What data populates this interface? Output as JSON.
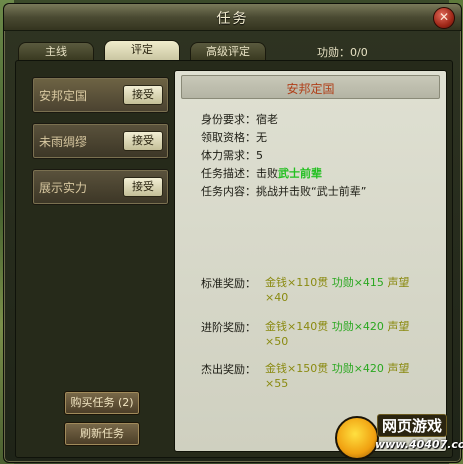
{
  "window": {
    "title": "任务",
    "close_label": "✕"
  },
  "tabs": [
    {
      "label": "主线",
      "active": false
    },
    {
      "label": "评定",
      "active": true
    },
    {
      "label": "高级评定",
      "active": false
    }
  ],
  "merit": {
    "label": "功勋：0/0"
  },
  "quest_list": [
    {
      "name": "安邦定国",
      "accept_label": "接受",
      "selected": true
    },
    {
      "name": "未雨绸缪",
      "accept_label": "接受",
      "selected": false
    },
    {
      "name": "展示实力",
      "accept_label": "接受",
      "selected": false
    }
  ],
  "buttons": {
    "buy": "购买任务 (2)",
    "refresh": "刷新任务"
  },
  "detail": {
    "title": "安邦定国",
    "identity_label": "身份要求：",
    "identity_value": "宿老",
    "qualification_label": "领取资格：",
    "qualification_value": "无",
    "stamina_label": "体力需求：",
    "stamina_value": "5",
    "desc_label": "任务描述：",
    "desc_prefix": "击败",
    "desc_target": "武士前辈",
    "content_label": "任务内容：",
    "content_value": "挑战并击败“武士前辈”"
  },
  "rewards": [
    {
      "label": "标准奖励：",
      "gold": "金钱×110贯",
      "merit": "功勋×415",
      "fame": "声望×40"
    },
    {
      "label": "进阶奖励：",
      "gold": "金钱×140贯",
      "merit": "功勋×420",
      "fame": "声望×50"
    },
    {
      "label": "杰出奖励：",
      "gold": "金钱×150贯",
      "merit": "功勋×420",
      "fame": "声望×55"
    }
  ],
  "watermark": {
    "title": "网页游戏",
    "url": "www.40407.com"
  },
  "colors": {
    "target_green": "#22c020",
    "detail_title": "#b0401a",
    "reward_gold": "#8a8a10"
  }
}
